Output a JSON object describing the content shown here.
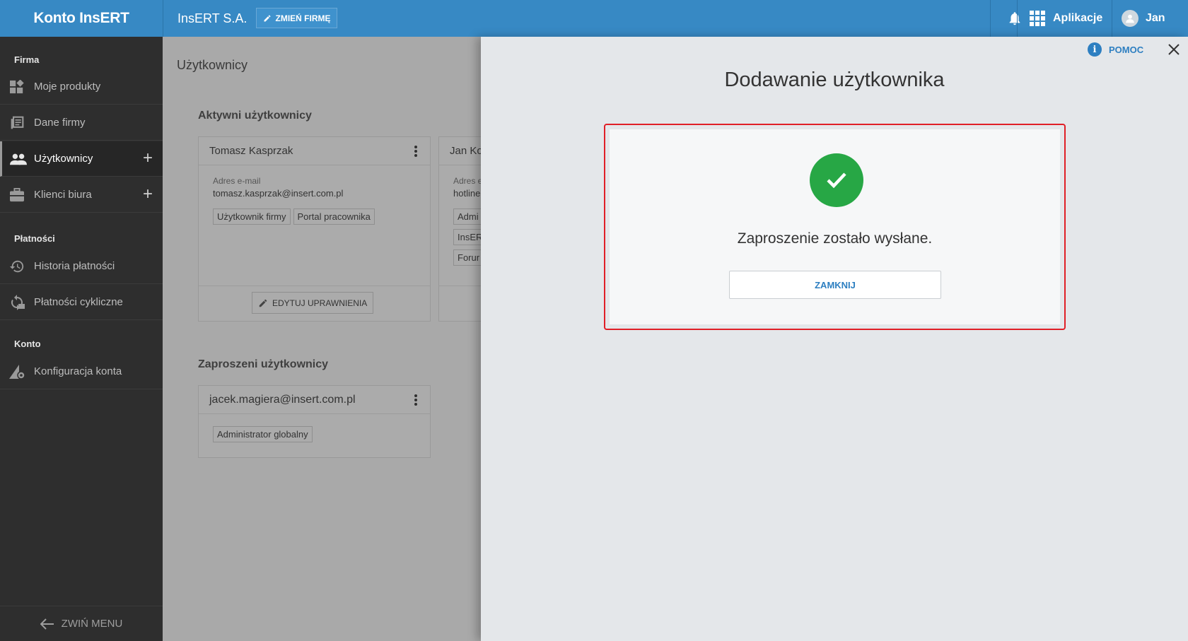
{
  "app": {
    "brand": "Konto InsERT",
    "company": "InsERT S.A.",
    "change_company": "ZMIEŃ FIRMĘ",
    "apps_label": "Aplikacje",
    "user_name": "Jan"
  },
  "sidebar": {
    "sections": [
      {
        "title": "Firma"
      },
      {
        "title": "Płatności"
      },
      {
        "title": "Konto"
      }
    ],
    "items": [
      {
        "label": "Moje produkty",
        "icon": "products-icon"
      },
      {
        "label": "Dane firmy",
        "icon": "company-data-icon"
      },
      {
        "label": "Użytkownicy",
        "icon": "users-icon",
        "active": true
      },
      {
        "label": "Klienci biura",
        "icon": "briefcase-icon"
      },
      {
        "label": "Historia płatności",
        "icon": "history-icon"
      },
      {
        "label": "Płatności cykliczne",
        "icon": "recurring-payments-icon"
      },
      {
        "label": "Konfiguracja konta",
        "icon": "account-config-icon"
      }
    ],
    "collapse": "ZWIŃ MENU"
  },
  "main": {
    "title": "Użytkownicy",
    "active_heading": "Aktywni użytkownicy",
    "invited_heading": "Zaproszeni użytkownicy",
    "card1": {
      "name": "Tomasz Kasprzak",
      "email_label": "Adres e-mail",
      "email": "tomasz.kasprzak@insert.com.pl",
      "tags": [
        "Użytkownik firmy",
        "Portal pracownika"
      ],
      "edit": "EDYTUJ UPRAWNIENIA"
    },
    "card2": {
      "name": "Jan Ko",
      "email_label": "Adres e",
      "email": "hotline",
      "tags": [
        "Admi",
        "InsER",
        "Forur"
      ]
    },
    "invited_card": {
      "email": "jacek.magiera@insert.com.pl",
      "tag": "Administrator globalny"
    }
  },
  "panel": {
    "help": "POMOC",
    "title": "Dodawanie użytkownika",
    "message": "Zaproszenie zostało wysłane.",
    "close_button": "ZAMKNIJ"
  },
  "colors": {
    "topbar": "#3789c4",
    "success": "#27a745",
    "highlight": "#e01f27",
    "link": "#2d7fc1"
  }
}
